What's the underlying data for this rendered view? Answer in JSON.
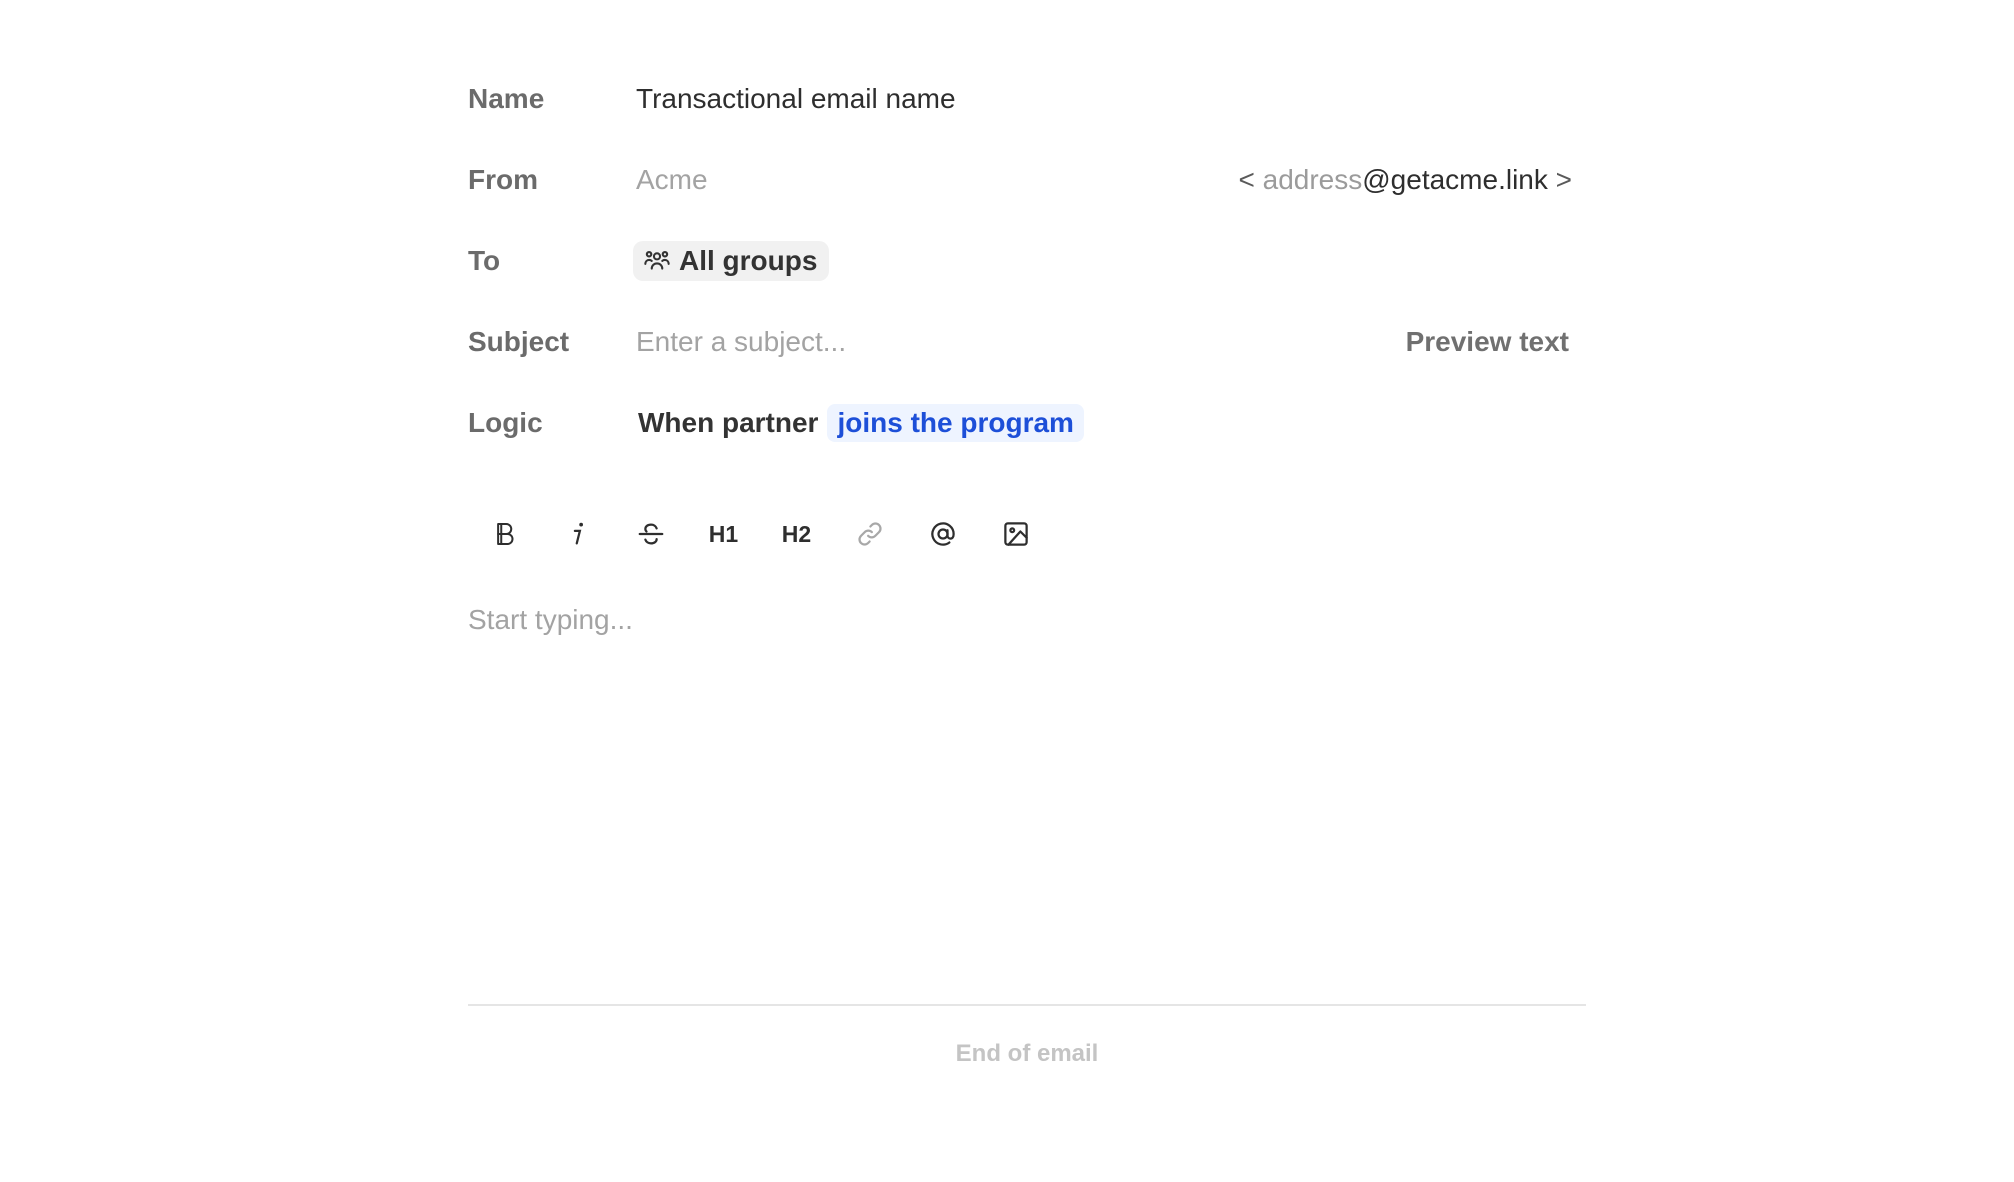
{
  "form": {
    "name": {
      "label": "Name",
      "value": "Transactional email name"
    },
    "from": {
      "label": "From",
      "placeholder": "Acme",
      "address_open": "< ",
      "address_placeholder": "address",
      "address_domain": "@getacme.link",
      "address_close": " >"
    },
    "to": {
      "label": "To",
      "chip_label": "All groups",
      "chip_icon": "users-group-icon"
    },
    "subject": {
      "label": "Subject",
      "placeholder": "Enter a subject...",
      "preview_label": "Preview text"
    },
    "logic": {
      "label": "Logic",
      "prefix": "When partner",
      "trigger": "joins the program"
    }
  },
  "toolbar": {
    "bold_icon": "bold-icon",
    "italic_icon": "italic-icon",
    "strike_icon": "strikethrough-icon",
    "h1": "H1",
    "h2": "H2",
    "link_icon": "link-icon",
    "mention_icon": "at-mention-icon",
    "image_icon": "image-icon"
  },
  "editor": {
    "placeholder": "Start typing..."
  },
  "footer": {
    "end_label": "End of email"
  },
  "colors": {
    "label": "#6b6b6b",
    "placeholder": "#a3a3a3",
    "chip_bg": "#f1f1f1",
    "logic_chip_bg": "#eef4ff",
    "logic_chip_text": "#1d4fd8",
    "divider": "#e5e5e5"
  }
}
